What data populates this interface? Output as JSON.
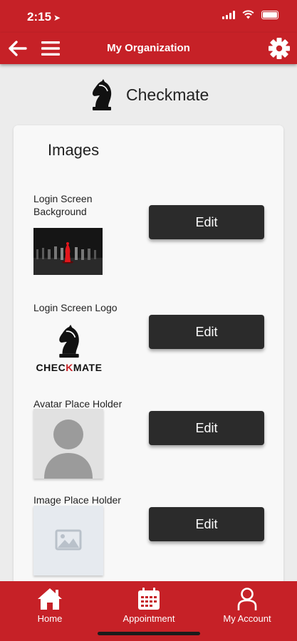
{
  "status_bar": {
    "time": "2:15",
    "location_icon": "location-arrow-icon"
  },
  "app_bar": {
    "title": "My Organization"
  },
  "organization": {
    "name": "Checkmate"
  },
  "card": {
    "title": "Images",
    "items": [
      {
        "label": "Login Screen Background",
        "button": "Edit"
      },
      {
        "label": "Login Screen Logo",
        "button": "Edit",
        "logo_text_prefix": "CHEC",
        "logo_text_highlight": "K",
        "logo_text_suffix": "MATE"
      },
      {
        "label": "Avatar Place Holder",
        "button": "Edit"
      },
      {
        "label": "Image Place Holder",
        "button": "Edit"
      }
    ]
  },
  "tab_bar": {
    "tabs": [
      {
        "label": "Home",
        "icon": "home-icon"
      },
      {
        "label": "Appointment",
        "icon": "calendar-icon"
      },
      {
        "label": "My Account",
        "icon": "user-icon"
      }
    ]
  },
  "colors": {
    "brand_red": "#c62127",
    "button_dark": "#2b2b2b",
    "background": "#ececec"
  }
}
